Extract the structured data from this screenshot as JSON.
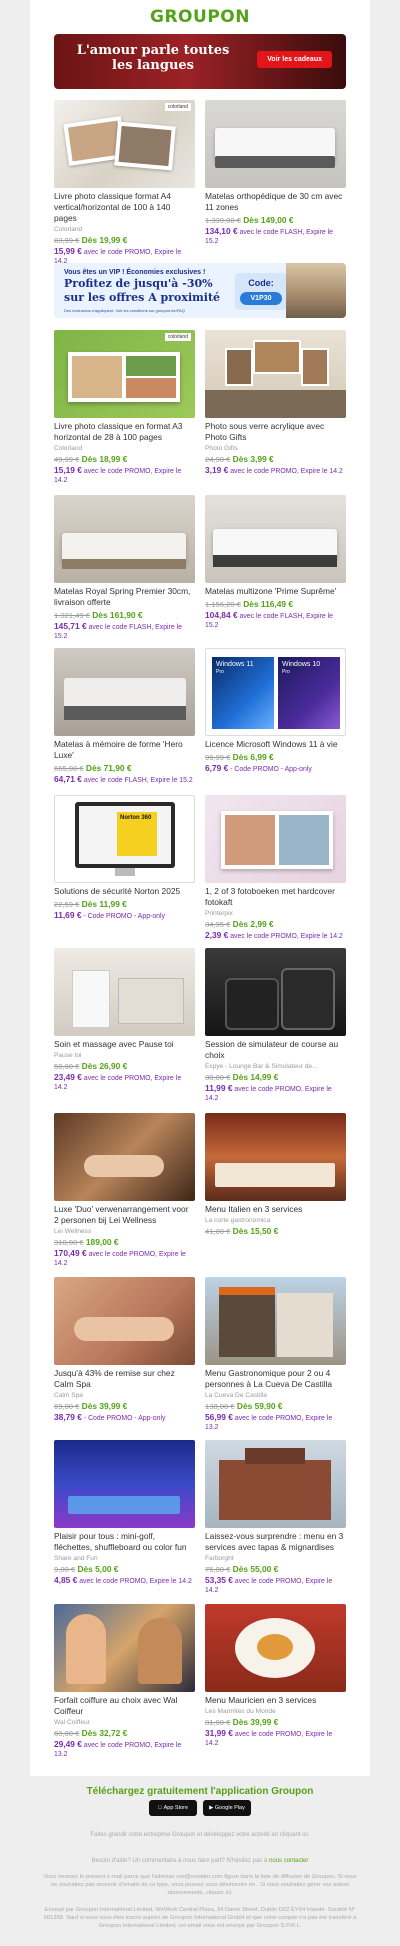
{
  "brand": {
    "logo": "GROUPON",
    "green": "#53a318",
    "purple": "#7b2bb0"
  },
  "banner1": {
    "text": "L'amour parle toutes les langues",
    "button": "Voir les cadeaux"
  },
  "banner2": {
    "line1": "Vous êtes un VIP ! Économies exclusives !",
    "line2": "Profitez de jusqu'à -30%",
    "line3": "sur les offres A proximité",
    "line4": "Des exclusions s'appliquent. Voir les conditions sur groupon.be/FAQ",
    "code_label": "Code:",
    "code": "V1P30"
  },
  "deals": [
    {
      "title": "Livre photo classique format A4 vertical/horizontal de 100 à 140 pages",
      "merchant": "Colorland",
      "old": "83,99 €",
      "from": "Dès 19,99 €",
      "promo_price": "15,99 €",
      "promo_text": "avec le code PROMO, Expire le 14.2"
    },
    {
      "title": "Matelas orthopédique de 30 cm avec 11 zones",
      "merchant": "",
      "old": "1.339,00 €",
      "from": "Dès 149,00 €",
      "promo_price": "134,10 €",
      "promo_text": "avec le code FLASH, Expire le 15.2"
    },
    {
      "title": "Livre photo classique en format A3 horizontal de 28 à 100 pages",
      "merchant": "Colorland",
      "old": "49,99 €",
      "from": "Dès 18,99 €",
      "promo_price": "15,19 €",
      "promo_text": "avec le code PROMO, Expire le 14.2"
    },
    {
      "title": "Photo sous verre acrylique avec Photo Gifts",
      "merchant": "Photo Gifts",
      "old": "24,90 €",
      "from": "Dès 3,99 €",
      "promo_price": "3,19 €",
      "promo_text": "avec le code PROMO, Expire le 14.2"
    },
    {
      "title": "Matelas Royal Spring Premier 30cm, livraison offerte",
      "merchant": "",
      "old": "1.321,49 €",
      "from": "Dès 161,90 €",
      "promo_price": "145,71 €",
      "promo_text": "avec le code FLASH, Expire le 15.2"
    },
    {
      "title": "Matelas multizone 'Prime Suprême'",
      "merchant": "",
      "old": "1.156,20 €",
      "from": "Dès 116,49 €",
      "promo_price": "104,84 €",
      "promo_text": "avec le code FLASH, Expire le 15.2"
    },
    {
      "title": "Matelas à mémoire de forme 'Hero Luxe'",
      "merchant": "",
      "old": "665,00 €",
      "from": "Dès 71,90 €",
      "promo_price": "64,71 €",
      "promo_text": "avec le code FLASH, Expire le 15.2"
    },
    {
      "title": "Licence Microsoft Windows 11 à vie",
      "merchant": "",
      "old": "99,99 €",
      "from": "Dès 6,99 €",
      "promo_price": "6,79 €",
      "promo_text": "- Code PROMO - App-only"
    },
    {
      "title": "Solutions de sécurité Norton 2025",
      "merchant": "",
      "old": "22,59 €",
      "from": "Dès 11,99 €",
      "promo_price": "11,69 €",
      "promo_text": "- Code PROMO - App-only"
    },
    {
      "title": "1, 2 of 3 fotoboeken met hardcover fotokaft",
      "merchant": "Printerpix",
      "old": "34,95 €",
      "from": "Dès 2,99 €",
      "promo_price": "2,39 €",
      "promo_text": "avec le code PROMO, Expire le 14.2"
    },
    {
      "title": "Soin et massage avec Pause toi",
      "merchant": "Pause toi",
      "old": "50,00 €",
      "from": "Dès 26,90 €",
      "promo_price": "23,49 €",
      "promo_text": "avec le code PROMO, Expire le 14.2"
    },
    {
      "title": "Session de simulateur de course au choix",
      "merchant": "Expye - Lounge Bar & Simulateur de...",
      "old": "30,00 €",
      "from": "Dès 14,99 €",
      "promo_price": "11,99 €",
      "promo_text": "avec le code PROMO, Expire le 14.2"
    },
    {
      "title": "Luxe 'Duo' verwenarrangement voor 2 personen bij Lei Wellness",
      "merchant": "Lei Wellness",
      "old": "310,00 €",
      "from": "189,00 €",
      "promo_price": "170,49 €",
      "promo_text": "avec le code PROMO, Expire le 14.2"
    },
    {
      "title": "Menu Italien en 3 services",
      "merchant": "La corte gastronomica",
      "old": "41,00 €",
      "from": "Dès 15,50 €",
      "promo_price": "",
      "promo_text": ""
    },
    {
      "title": "Jusqu'à 43% de remise sur chez Calm Spa",
      "merchant": "Calm Spa",
      "old": "69,00 €",
      "from": "Dès 39,99 €",
      "promo_price": "38,79 €",
      "promo_text": "- Code PROMO - App-only"
    },
    {
      "title": "Menu Gastronomique pour 2 ou 4 personnes à La Cueva De Castilla",
      "merchant": "La Cueva De Castilla",
      "old": "138,00 €",
      "from": "Dès 59,90 €",
      "promo_price": "56,99 €",
      "promo_text": "avec le code PROMO, Expire le 13.2"
    },
    {
      "title": "Plaisir pour tous : mini-golf, fléchettes, shuffleboard ou color fun",
      "merchant": "Share and Fun",
      "old": "9,00 €",
      "from": "Dès 5,00 €",
      "promo_price": "4,85 €",
      "promo_text": "avec le code PROMO, Expire le 14.2"
    },
    {
      "title": "Laissez-vous surprendre : menu en 3 services avec tapas & mignardises",
      "merchant": "Farborght",
      "old": "75,00 €",
      "from": "Dès 55,00 €",
      "promo_price": "53,35 €",
      "promo_text": "avec le code PROMO, Expire le 14.2"
    },
    {
      "title": "Forfait coiffure au choix avec Wal Coiffeur",
      "merchant": "Wal Coiffeur",
      "old": "60,00 €",
      "from": "Dès 32,72 €",
      "promo_price": "29,49 €",
      "promo_text": "avec le code PROMO, Expire le 13.2"
    },
    {
      "title": "Menu Mauricien en 3 services",
      "merchant": "Les Marmites du Monde",
      "old": "81,00 €",
      "from": "Dès 39,99 €",
      "promo_price": "31,99 €",
      "promo_text": "avec le code PROMO, Expire le 14.2"
    }
  ],
  "image_labels": {
    "windows11": "Windows 11",
    "windows10": "Windows 10",
    "pro": "Pro",
    "norton": "Norton 360",
    "colorland": "colorland"
  },
  "footer": {
    "app_cta": "Téléchargez gratuitement l'application Groupon",
    "app_store": "App Store",
    "google_play": "Google Play",
    "line1": "Faites grandir votre entreprise Groupon et développez votre activité en cliquant ici.",
    "line2_pre": "Besoin d'aide? Un commentaire à nous faire part? N'hésitez pas à",
    "line2_link": "nous contacter",
    "line3": "Vous recevez le présent e-mail parce que l'adresse xxx@xreader.com figure dans la liste de diffusion de Groupon. Si vous ne souhaitez pas recevoir d'emails de ce type, vous pouvez vous désinscrire en . Si vous souhaitez gérer vos autres abonnements, cliquez ici.",
    "line4": "Envoyé par Groupon International Limited, WeWork Central Plaza, 34 Dame Street, Dublin D02 EY64 Irlande. Société N° 501358. Sauf si vous vous êtes inscrit auprès de Groupon International GmbH et que votre compte n'a pas été transféré à Groupon International Limited, cet email vous est envoyé par Groupon S.P.R.L."
  }
}
